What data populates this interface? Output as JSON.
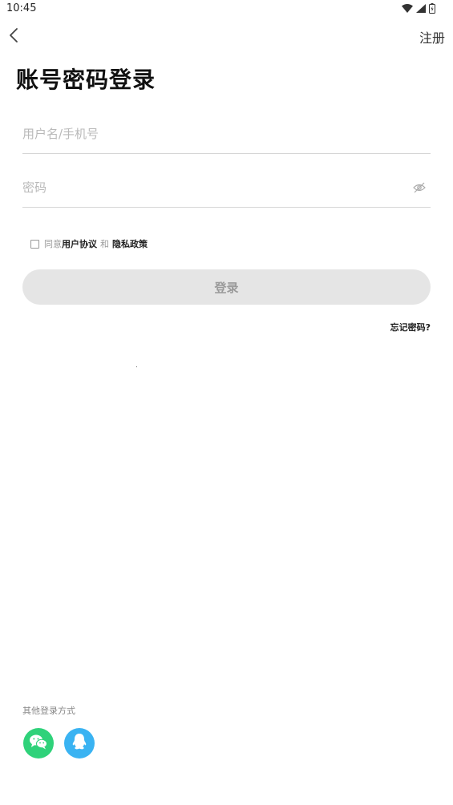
{
  "status_bar": {
    "time": "10:45",
    "icons": [
      "wifi-icon",
      "cellular-signal-icon",
      "battery-icon"
    ]
  },
  "nav": {
    "back_icon": "chevron-left-icon",
    "register_label": "注册"
  },
  "page": {
    "title": "账号密码登录"
  },
  "form": {
    "username_placeholder": "用户名/手机号",
    "username_value": "",
    "password_placeholder": "密码",
    "password_value": "",
    "password_toggle_icon": "eye-off-icon"
  },
  "agreement": {
    "checked": false,
    "prefix": "同意",
    "user_agreement": "用户协议",
    "conjunction": "和",
    "privacy_policy": "隐私政策"
  },
  "actions": {
    "login_label": "登录",
    "forgot_password_label": "忘记密码?"
  },
  "other_login": {
    "label": "其他登录方式",
    "methods": [
      "wechat-icon",
      "qq-icon"
    ]
  },
  "colors": {
    "wechat": "#2fd27a",
    "qq": "#3ab3f2",
    "login_button_bg": "#e5e5e5",
    "login_button_text": "#9a9a9a"
  }
}
